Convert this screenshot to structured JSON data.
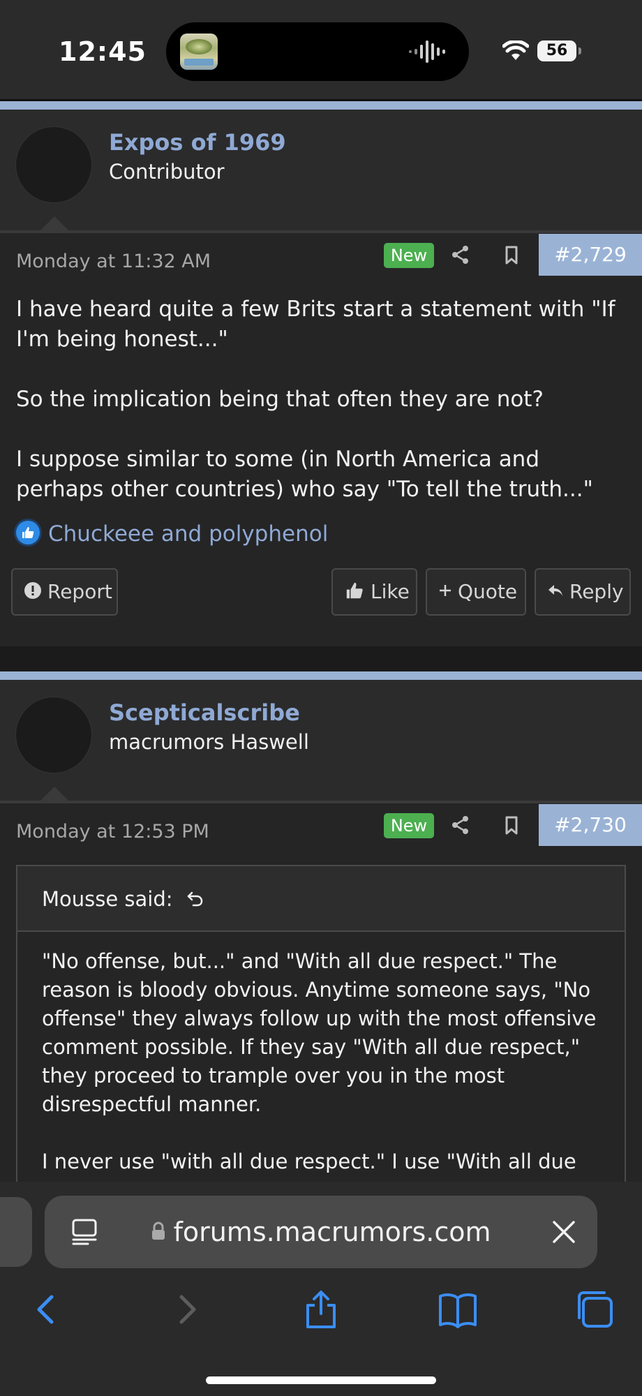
{
  "status_bar": {
    "time": "12:45",
    "battery": "56",
    "icons": [
      "now-playing-artwork",
      "audio-waveform-icon",
      "wifi-icon",
      "battery-icon"
    ]
  },
  "posts": [
    {
      "author": "Expos of 1969",
      "title": "Contributor",
      "date": "Monday at 11:32 AM",
      "badge": "New",
      "number": "#2,729",
      "body": [
        "I have heard quite a few Brits start a statement with \"If I'm being honest...\"",
        "So the implication being that often they are not?",
        "I suppose similar to some (in North America and perhaps other countries) who say \"To tell the truth...\""
      ],
      "reactions": "Chuckeee and polyphenol",
      "actions": {
        "report": "Report",
        "like": "Like",
        "quote": "Quote",
        "reply": "Reply"
      }
    },
    {
      "author": "Scepticalscribe",
      "title": "macrumors Haswell",
      "date": "Monday at 12:53 PM",
      "badge": "New",
      "number": "#2,730",
      "quote": {
        "header": "Mousse said:",
        "body": [
          "\"No offense, but...\" and \"With all due respect.\" The reason is bloody obvious. Anytime someone says, \"No offense\" they always follow up with the most offensive comment possible. If they say \"With all due respect,\" they proceed to trample over you in the most disrespectful manner.",
          "I never use \"with all due respect.\" I use \"With all due"
        ]
      }
    }
  ],
  "browser": {
    "url": "forums.macrumors.com",
    "toolbar": [
      "back-icon",
      "forward-icon",
      "share-icon",
      "bookmarks-icon",
      "tabs-icon"
    ]
  },
  "colors": {
    "accent_blue": "#9ab3d5",
    "link_blue": "#8fa9d4",
    "new_badge": "#4caf50",
    "safari_blue": "#3b8ef3"
  }
}
